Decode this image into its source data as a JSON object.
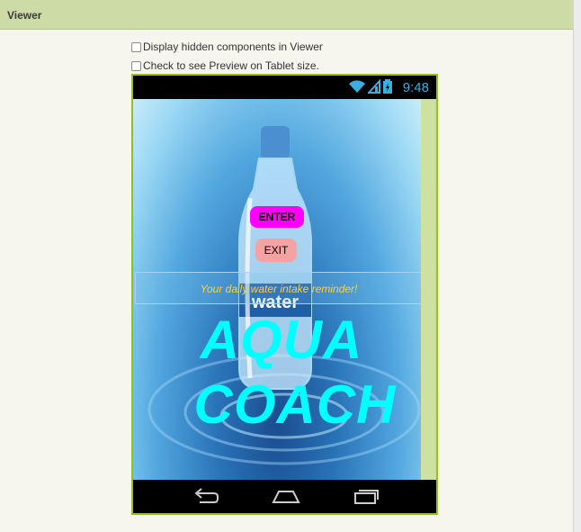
{
  "viewer": {
    "title": "Viewer"
  },
  "options": {
    "hidden_components_label": "Display hidden components in Viewer",
    "tablet_preview_label": "Check to see Preview on Tablet size."
  },
  "phone": {
    "status": {
      "time": "9:48"
    },
    "app": {
      "enter_label": "ENTER",
      "exit_label": "EXIT",
      "tagline": "Your daily water intake reminder!",
      "title_line1": "AQUA",
      "title_line2": "COACH",
      "bottle_label": "water"
    }
  },
  "colors": {
    "enter_button": "#ff00ff",
    "exit_button": "#f5a2a2",
    "title_text": "#00ffff",
    "tagline_text": "#ffd23f",
    "phone_border": "#94c01c",
    "header_bar": "#cddba6"
  }
}
